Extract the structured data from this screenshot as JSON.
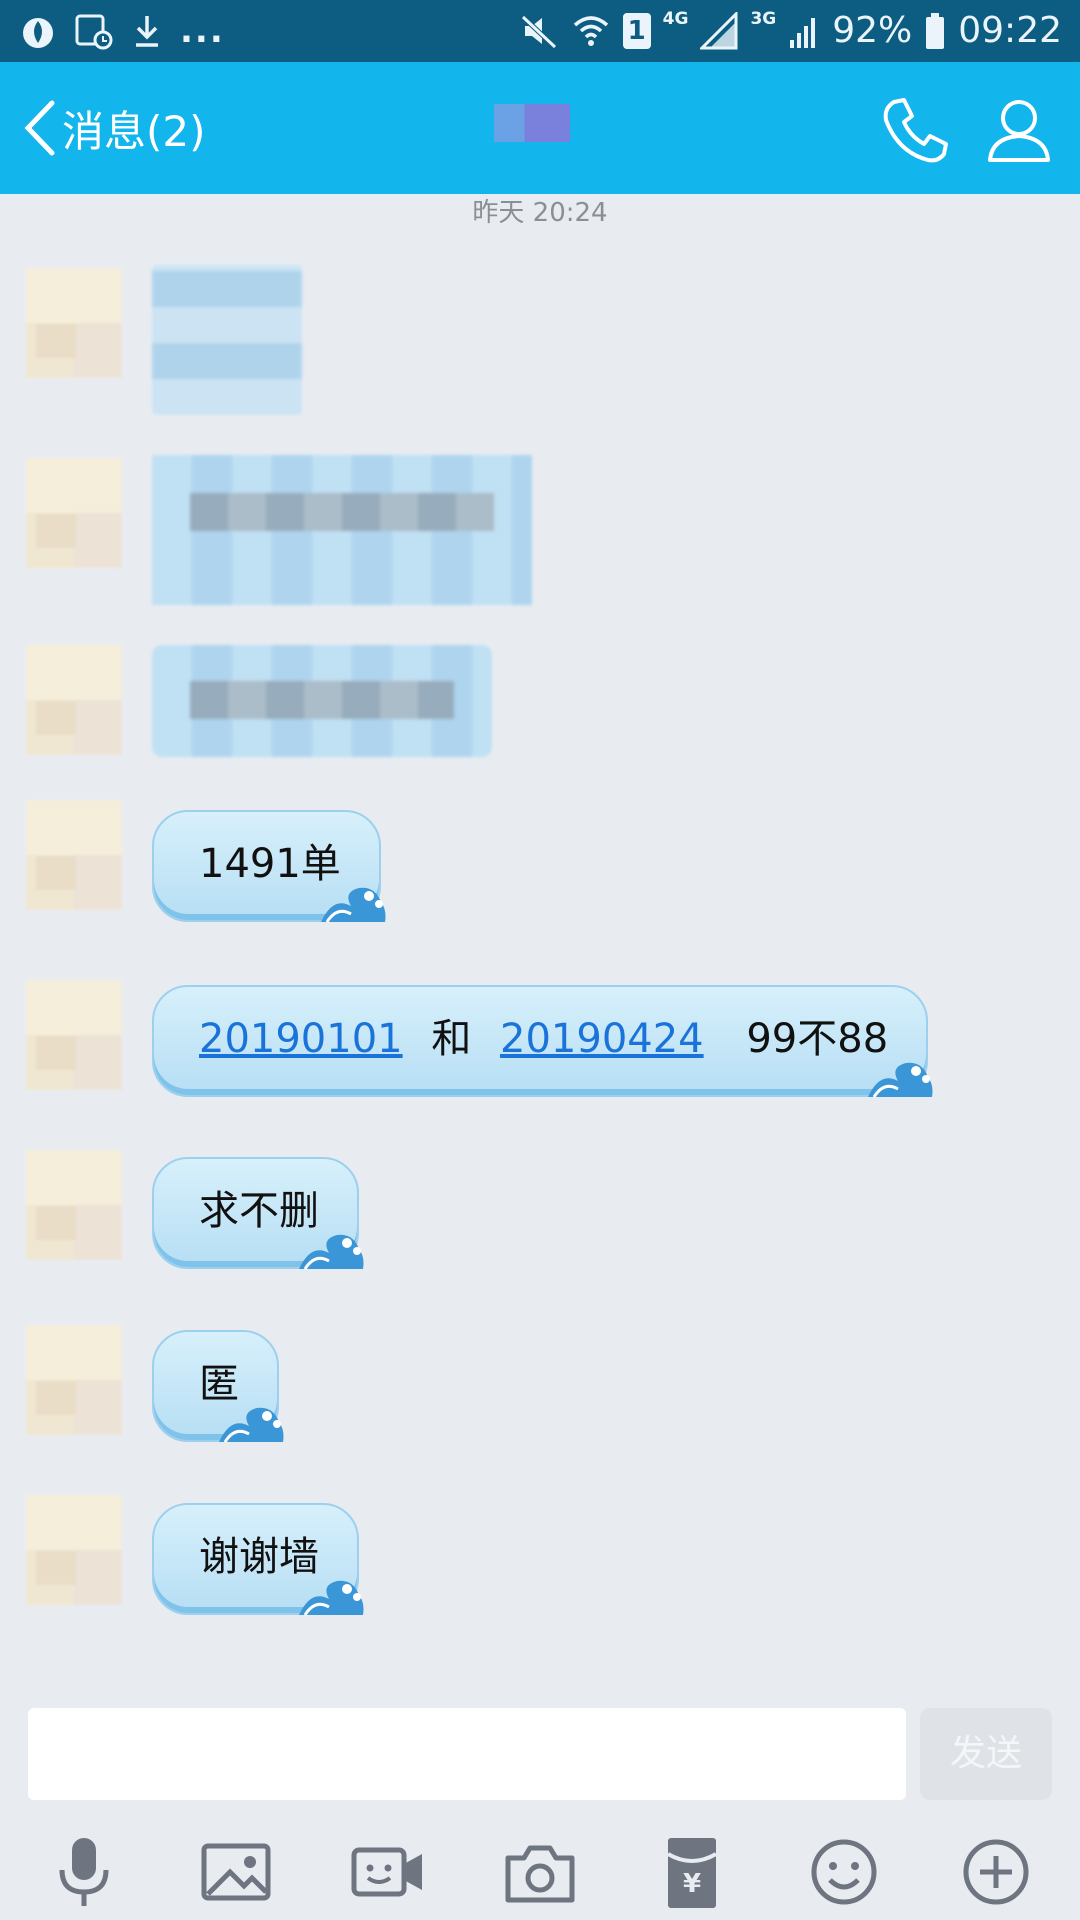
{
  "status_bar": {
    "network_4g": "4G",
    "network_3g": "3G",
    "sim_number": "1",
    "battery_percent": "92%",
    "time": "09:22",
    "ellipsis": "..."
  },
  "title_bar": {
    "back_label": "消息(2)"
  },
  "chat": {
    "timestamp": "昨天 20:24",
    "messages": [
      {
        "text": "1491单"
      },
      {
        "link_1": "20190101",
        "middle": "和",
        "link_2": "20190424",
        "suffix": "99不88"
      },
      {
        "text": "求不删"
      },
      {
        "text": "匿"
      },
      {
        "text": "谢谢墙"
      }
    ]
  },
  "input": {
    "value": "",
    "send_label": "发送"
  },
  "toolbar": {
    "icons": [
      "microphone-icon",
      "image-icon",
      "video-call-icon",
      "camera-icon",
      "red-packet-icon",
      "emoji-icon",
      "plus-icon"
    ]
  },
  "colors": {
    "status_bar": "#0d5d83",
    "title_bar": "#12b5ec",
    "chat_background": "#e8ecf1",
    "link": "#1a73d9"
  }
}
